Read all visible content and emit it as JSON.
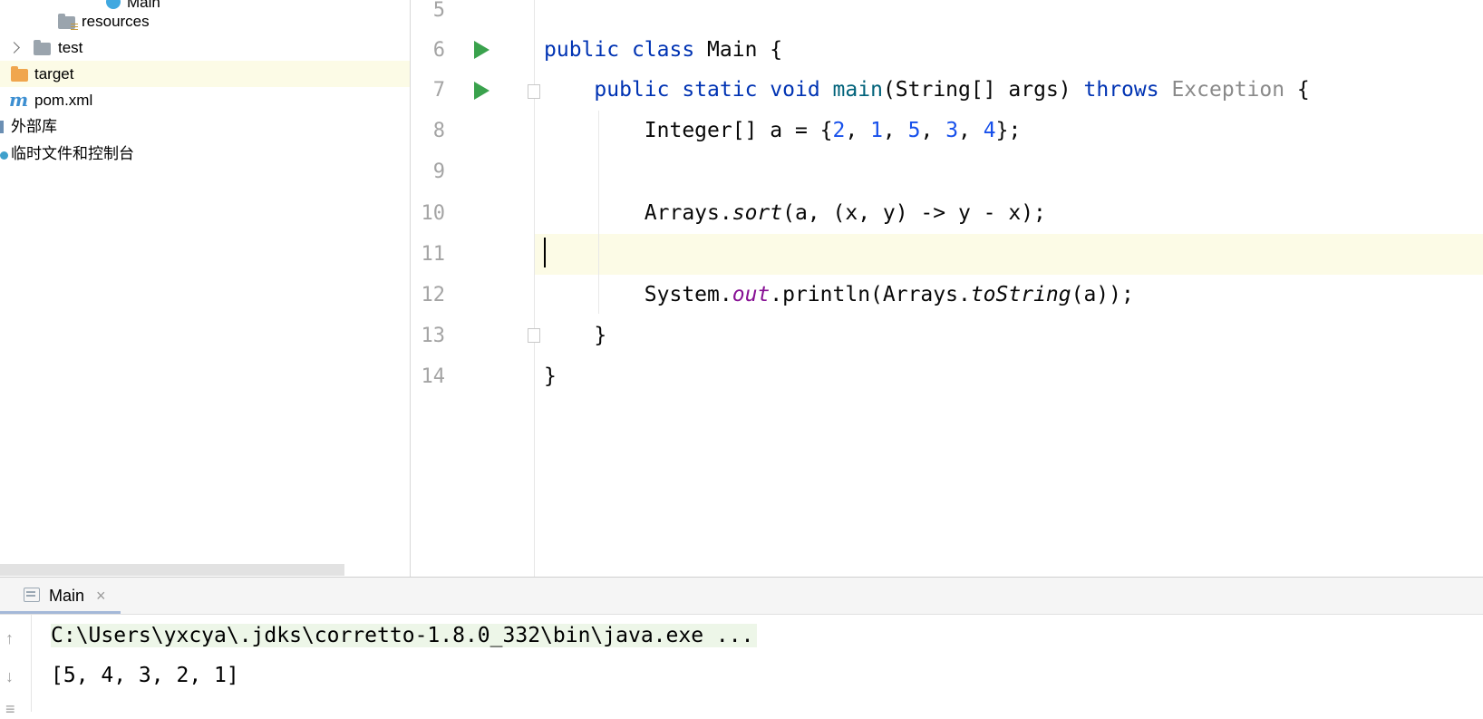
{
  "project_tree": {
    "items": [
      {
        "label": "Main",
        "icon": "class-icon"
      },
      {
        "label": "resources",
        "icon": "resources-folder-icon"
      },
      {
        "label": "test",
        "icon": "folder-icon"
      },
      {
        "label": "target",
        "icon": "folder-orange-icon"
      },
      {
        "label": "pom.xml",
        "icon": "maven-icon"
      },
      {
        "label": "外部库",
        "icon": "library-icon"
      },
      {
        "label": "临时文件和控制台",
        "icon": "scratch-icon"
      }
    ],
    "selected": "target"
  },
  "editor": {
    "line_numbers": [
      "5",
      "6",
      "7",
      "8",
      "9",
      "10",
      "11",
      "12",
      "13",
      "14"
    ],
    "current_line": "11",
    "code": {
      "l6": [
        "public",
        " ",
        "class",
        " Main {"
      ],
      "l7": [
        "public",
        " ",
        "static",
        " ",
        "void",
        " ",
        "main",
        "(String[] args) ",
        "throws",
        " ",
        "Exception",
        " {"
      ],
      "l8": [
        "Integer[] a = {",
        "2",
        ", ",
        "1",
        ", ",
        "5",
        ", ",
        "3",
        ", ",
        "4",
        "};"
      ],
      "l10": [
        "Arrays.",
        "sort",
        "(a, (x, y) -> y - x);"
      ],
      "l12": [
        "System.",
        "out",
        ".println(Arrays.",
        "toString",
        "(a));"
      ],
      "l13": "}",
      "l14": "}"
    }
  },
  "run_panel": {
    "tab_label": "Main",
    "tab_close": "×",
    "command_line": "C:\\Users\\yxcya\\.jdks\\corretto-1.8.0_332\\bin\\java.exe ...",
    "output": "[5, 4, 3, 2, 1]",
    "tool_icons": [
      "up-arrow-icon",
      "down-arrow-icon",
      "wrap-icon"
    ]
  },
  "colors": {
    "keyword": "#0033b3",
    "number": "#1750eb",
    "static_field": "#871094",
    "run_gutter": "#3aa24d",
    "current_line": "#fcfbe6",
    "command_highlight": "#edf6e8"
  }
}
